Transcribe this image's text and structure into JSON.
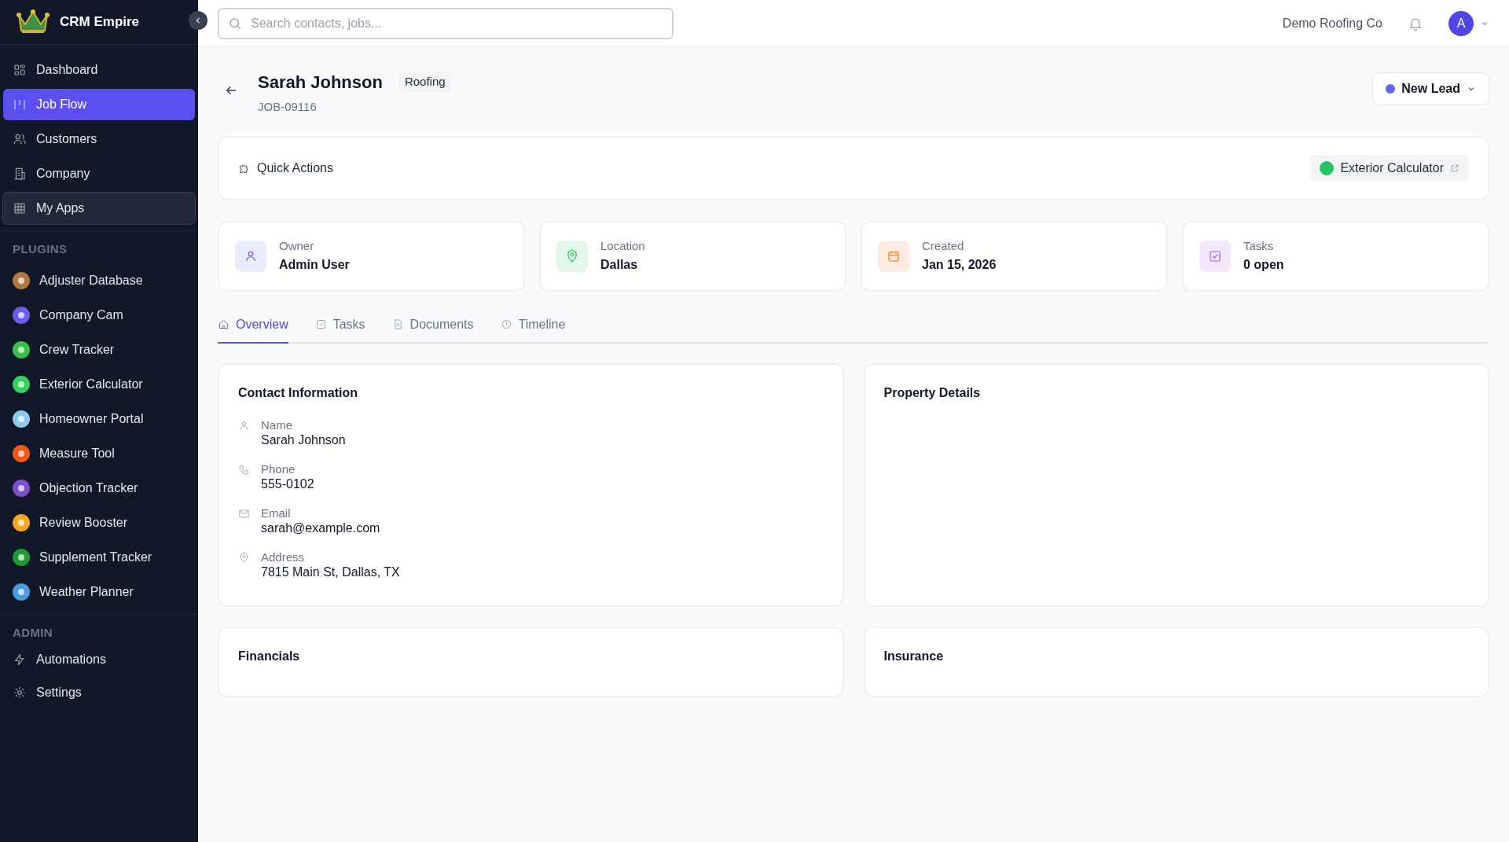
{
  "brand": {
    "name": "CRM Empire"
  },
  "nav": [
    {
      "label": "Dashboard",
      "selected": false,
      "highlighted": false
    },
    {
      "label": "Job Flow",
      "selected": true,
      "highlighted": false
    },
    {
      "label": "Customers",
      "selected": false,
      "highlighted": false
    },
    {
      "label": "Company",
      "selected": false,
      "highlighted": false
    },
    {
      "label": "My Apps",
      "selected": false,
      "highlighted": true
    }
  ],
  "plugins": {
    "heading": "PLUGINS",
    "items": [
      {
        "label": "Adjuster Database",
        "color": "#b07a3c"
      },
      {
        "label": "Company Cam",
        "color": "#6d5ce8"
      },
      {
        "label": "Crew Tracker",
        "color": "#3bbf4a"
      },
      {
        "label": "Exterior Calculator",
        "color": "#37d060"
      },
      {
        "label": "Homeowner Portal",
        "color": "#8fc8ee"
      },
      {
        "label": "Measure Tool",
        "color": "#f0591e"
      },
      {
        "label": "Objection Tracker",
        "color": "#7a4fc9"
      },
      {
        "label": "Review Booster",
        "color": "#f5a623"
      },
      {
        "label": "Supplement Tracker",
        "color": "#1f9a35"
      },
      {
        "label": "Weather Planner",
        "color": "#4a9be0"
      }
    ]
  },
  "admin": {
    "heading": "ADMIN",
    "items": [
      {
        "label": "Automations"
      },
      {
        "label": "Settings"
      }
    ]
  },
  "topbar": {
    "search_placeholder": "Search contacts, jobs...",
    "company": "Demo Roofing Co",
    "avatar": "A"
  },
  "job": {
    "name": "Sarah Johnson",
    "trade": "Roofing",
    "number": "JOB-09116",
    "status": {
      "label": "New Lead",
      "color": "#6366f1"
    }
  },
  "quick_actions": {
    "title": "Quick Actions",
    "action": {
      "label": "Exterior Calculator",
      "color": "#22c55e"
    }
  },
  "stats": [
    {
      "label": "Owner",
      "value": "Admin User",
      "color": "#6366f1"
    },
    {
      "label": "Location",
      "value": "Dallas",
      "color": "#22c55e"
    },
    {
      "label": "Created",
      "value": "Jan 15, 2026",
      "color": "#f97316"
    },
    {
      "label": "Tasks",
      "value": "0 open",
      "color": "#a855f7"
    }
  ],
  "tabs": [
    {
      "label": "Overview",
      "selected": true
    },
    {
      "label": "Tasks",
      "selected": false
    },
    {
      "label": "Documents",
      "selected": false
    },
    {
      "label": "Timeline",
      "selected": false
    }
  ],
  "contact": {
    "title": "Contact Information",
    "fields": [
      {
        "label": "Name",
        "value": "Sarah Johnson"
      },
      {
        "label": "Phone",
        "value": "555-0102"
      },
      {
        "label": "Email",
        "value": "sarah@example.com"
      },
      {
        "label": "Address",
        "value": "7815 Main St, Dallas, TX"
      }
    ]
  },
  "panels": [
    {
      "title": "Property Details"
    },
    {
      "title": "Financials"
    },
    {
      "title": "Insurance"
    }
  ]
}
